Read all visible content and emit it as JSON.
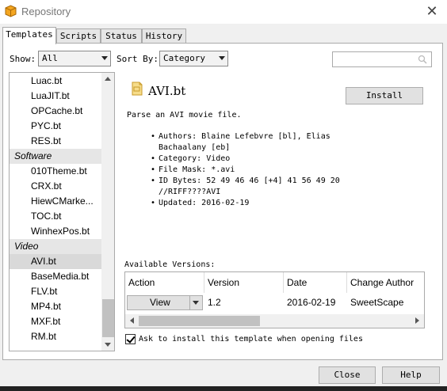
{
  "window": {
    "title": "Repository",
    "icon": "cube-icon",
    "close_label": "✕"
  },
  "tabs": [
    {
      "label": "Templates",
      "active": true
    },
    {
      "label": "Scripts",
      "active": false
    },
    {
      "label": "Status",
      "active": false
    },
    {
      "label": "History",
      "active": false
    }
  ],
  "filters": {
    "show_label": "Show:",
    "show_value": "All",
    "sort_label": "Sort By:",
    "sort_value": "Category",
    "search_value": ""
  },
  "list": {
    "items_a": [
      "Luac.bt",
      "LuaJIT.bt",
      "OPCache.bt",
      "PYC.bt",
      "RES.bt"
    ],
    "group_software": "Software",
    "items_b": [
      "010Theme.bt",
      "CRX.bt",
      "HiewCMarke...",
      "TOC.bt",
      "WinhexPos.bt"
    ],
    "group_video": "Video",
    "items_c": [
      "AVI.bt",
      "BaseMedia.bt",
      "FLV.bt",
      "MP4.bt",
      "MXF.bt",
      "RM.bt"
    ],
    "selected": "AVI.bt"
  },
  "template": {
    "title": "AVI.bt",
    "install_label": "Install",
    "description": "Parse an AVI movie file.",
    "properties": [
      "Authors: Blaine Lefebvre [bl], Elias Bachaalany [eb]",
      "Category: Video",
      "File Mask: *.avi",
      "ID Bytes: 52 49 46 46 [+4] 41 56 49 20 //RIFF????AVI",
      "Updated: 2016-02-19"
    ]
  },
  "versions": {
    "label": "Available Versions:",
    "headers": [
      "Action",
      "Version",
      "Date",
      "Change Author"
    ],
    "rows": [
      {
        "action": "View",
        "version": "1.2",
        "date": "2016-02-19",
        "author": "SweetScape"
      }
    ]
  },
  "ask_install": {
    "label": "Ask to install this template when opening files",
    "checked": true
  },
  "footer": {
    "close_label": "Close",
    "help_label": "Help"
  },
  "colors": {
    "selection": "#d9d9d9",
    "group_bg": "#e6e6e6",
    "icon_yellow": "#e8b84a"
  }
}
